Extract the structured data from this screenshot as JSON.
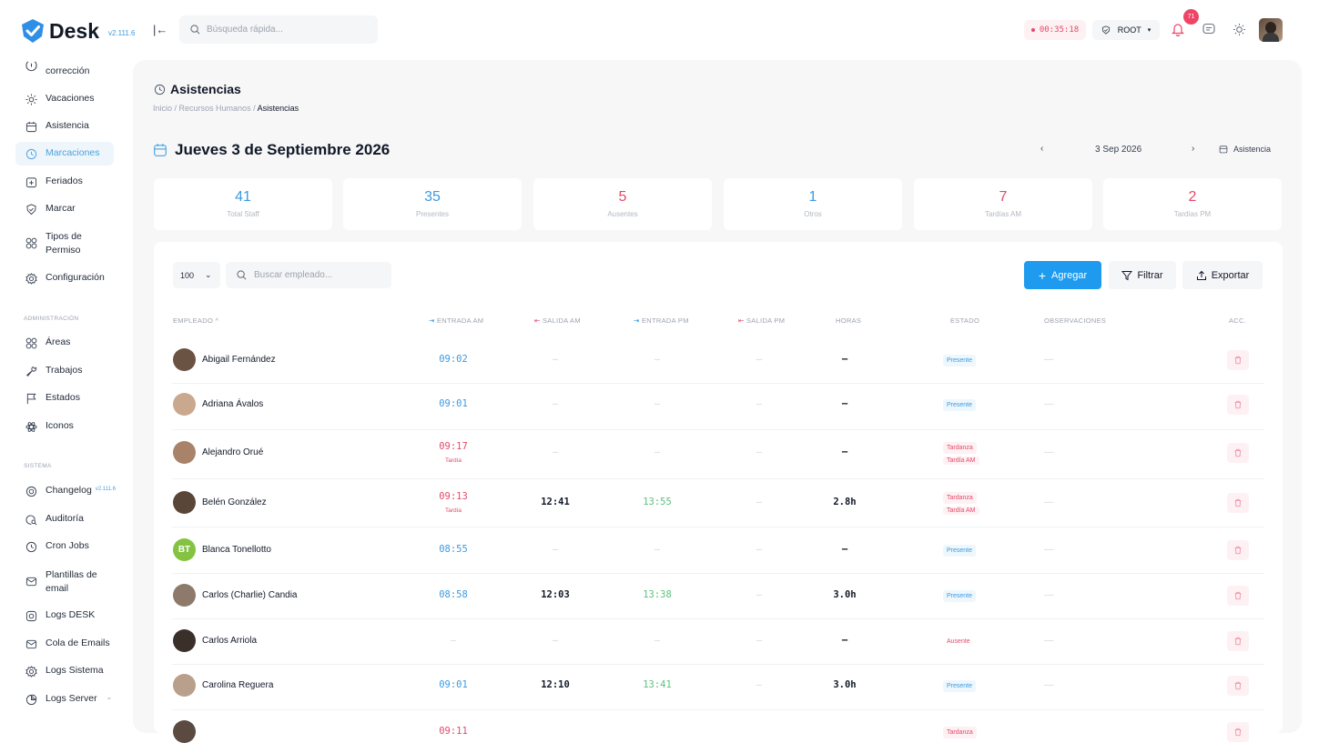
{
  "app": {
    "name": "Desk",
    "version": "v2.111.6"
  },
  "topbar": {
    "search_placeholder": "Búsqueda rápida...",
    "timer": "00:35:18",
    "role": "ROOT",
    "notifications_count": "71"
  },
  "sidebar": {
    "items_top": [
      {
        "label": "corrección",
        "icon": "alert-circle-icon"
      },
      {
        "label": "Vacaciones",
        "icon": "sun-icon"
      },
      {
        "label": "Asistencia",
        "icon": "calendar-icon"
      },
      {
        "label": "Marcaciones",
        "icon": "clock-icon",
        "active": true
      },
      {
        "label": "Feriados",
        "icon": "calendar-plus-icon"
      },
      {
        "label": "Marcar",
        "icon": "shield-check-icon"
      },
      {
        "label": "Tipos de Permiso",
        "icon": "grid-icon"
      },
      {
        "label": "Configuración",
        "icon": "gear-icon"
      }
    ],
    "section_admin": "ADMINISTRACIÓN",
    "items_admin": [
      {
        "label": "Áreas",
        "icon": "grid-icon"
      },
      {
        "label": "Trabajos",
        "icon": "wrench-icon"
      },
      {
        "label": "Estados",
        "icon": "flag-icon"
      },
      {
        "label": "Iconos",
        "icon": "atom-icon"
      }
    ],
    "section_system": "SISTEMA",
    "items_system": [
      {
        "label": "Changelog",
        "icon": "history-icon",
        "tag": "v2.111.6"
      },
      {
        "label": "Auditoría",
        "icon": "search-doc-icon"
      },
      {
        "label": "Cron Jobs",
        "icon": "clock-icon"
      },
      {
        "label": "Plantillas de email",
        "icon": "mail-icon"
      },
      {
        "label": "Logs DESK",
        "icon": "file-icon"
      },
      {
        "label": "Cola de Emails",
        "icon": "mail-icon"
      },
      {
        "label": "Logs Sistema",
        "icon": "gear-icon"
      },
      {
        "label": "Logs Server",
        "icon": "pie-icon"
      }
    ]
  },
  "page": {
    "title": "Asistencias",
    "breadcrumb": [
      "Inicio",
      "Recursos Humanos",
      "Asistencias"
    ],
    "date_heading": "Jueves 3 de Septiembre 2026",
    "date_short": "3 Sep 2026",
    "view_button": "Asistencia"
  },
  "stats": [
    {
      "value": "41",
      "label": "Total Staff",
      "color": "#3b9ae1"
    },
    {
      "value": "35",
      "label": "Presentes",
      "color": "#3b9ae1"
    },
    {
      "value": "5",
      "label": "Ausentes",
      "color": "#e34a6a"
    },
    {
      "value": "1",
      "label": "Otros",
      "color": "#3b9ae1"
    },
    {
      "value": "7",
      "label": "Tardías AM",
      "color": "#e34a6a"
    },
    {
      "value": "2",
      "label": "Tardías PM",
      "color": "#e34a6a"
    }
  ],
  "toolbar": {
    "page_size": "100",
    "search_placeholder": "Buscar empleado...",
    "add_label": "Agregar",
    "filter_label": "Filtrar",
    "export_label": "Exportar"
  },
  "table": {
    "headers": {
      "employee": "EMPLEADO",
      "in_am": "ENTRADA AM",
      "out_am": "SALIDA AM",
      "in_pm": "ENTRADA PM",
      "out_pm": "SALIDA PM",
      "hours": "HORAS",
      "status": "ESTADO",
      "notes": "OBSERVACIONES",
      "actions": "ACC."
    },
    "rows": [
      {
        "name": "Abigail Fernández",
        "avatar": "#6b5344",
        "in_am": "09:02",
        "in_am_late": false,
        "in_am_tag": "",
        "out_am": "—",
        "in_pm": "—",
        "out_pm": "—",
        "hours": "–",
        "status": "Presente",
        "status2": "",
        "status_kind": "pres",
        "notes": "—"
      },
      {
        "name": "Adriana Ávalos",
        "avatar": "#c9a88e",
        "in_am": "09:01",
        "in_am_late": false,
        "in_am_tag": "",
        "out_am": "—",
        "in_pm": "—",
        "out_pm": "—",
        "hours": "–",
        "status": "Presente",
        "status2": "",
        "status_kind": "pres",
        "notes": "—"
      },
      {
        "name": "Alejandro Orué",
        "avatar": "#a8836a",
        "in_am": "09:17",
        "in_am_late": true,
        "in_am_tag": "Tardía",
        "out_am": "—",
        "in_pm": "—",
        "out_pm": "—",
        "hours": "–",
        "status": "Tardanza",
        "status2": "Tardía AM",
        "status_kind": "late",
        "notes": "—"
      },
      {
        "name": "Belén González",
        "avatar": "#5a4638",
        "in_am": "09:13",
        "in_am_late": true,
        "in_am_tag": "Tardía",
        "out_am": "12:41",
        "in_pm": "13:55",
        "out_pm": "—",
        "hours": "2.8h",
        "status": "Tardanza",
        "status2": "Tardía AM",
        "status_kind": "late",
        "notes": "—"
      },
      {
        "name": "Blanca Tonellotto",
        "avatar": "#84c341",
        "initials": "BT",
        "in_am": "08:55",
        "in_am_late": false,
        "in_am_tag": "",
        "out_am": "—",
        "in_pm": "—",
        "out_pm": "—",
        "hours": "–",
        "status": "Presente",
        "status2": "",
        "status_kind": "pres",
        "notes": "—"
      },
      {
        "name": "Carlos (Charlie) Candia",
        "avatar": "#8d7a6a",
        "in_am": "08:58",
        "in_am_late": false,
        "in_am_tag": "",
        "out_am": "12:03",
        "in_pm": "13:38",
        "out_pm": "—",
        "hours": "3.0h",
        "status": "Presente",
        "status2": "",
        "status_kind": "pres",
        "notes": "—"
      },
      {
        "name": "Carlos Arriola",
        "avatar": "#3b2f2a",
        "in_am": "—",
        "in_am_late": false,
        "in_am_tag": "",
        "out_am": "—",
        "in_pm": "—",
        "out_pm": "—",
        "hours": "–",
        "status": "Ausente",
        "status2": "",
        "status_kind": "abs",
        "notes": "—"
      },
      {
        "name": "Carolina Reguera",
        "avatar": "#b8a08c",
        "in_am": "09:01",
        "in_am_late": false,
        "in_am_tag": "",
        "out_am": "12:10",
        "in_pm": "13:41",
        "out_pm": "—",
        "hours": "3.0h",
        "status": "Presente",
        "status2": "",
        "status_kind": "pres",
        "notes": "—"
      },
      {
        "name": "",
        "avatar": "#5a4a40",
        "in_am": "09:11",
        "in_am_late": true,
        "in_am_tag": "",
        "out_am": "",
        "in_pm": "",
        "out_pm": "",
        "hours": "",
        "status": "Tardanza",
        "status2": "",
        "status_kind": "late",
        "notes": ""
      }
    ]
  }
}
